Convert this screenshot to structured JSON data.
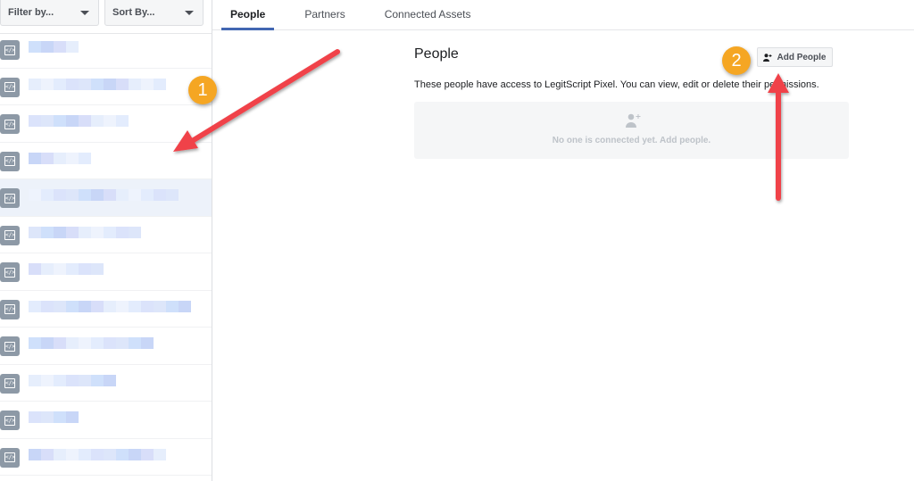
{
  "sidebar": {
    "filter_label": "Filter by...",
    "sort_label": "Sort By...",
    "item_count": 12,
    "selected_index": 4,
    "item_text_note": "pixelated/redacted"
  },
  "tabs": [
    {
      "label": "People",
      "active": true
    },
    {
      "label": "Partners",
      "active": false
    },
    {
      "label": "Connected Assets",
      "active": false
    }
  ],
  "panel": {
    "title": "People",
    "add_button_label": "Add People",
    "description": "These people have access to LegitScript Pixel. You can view, edit or delete their permissions.",
    "empty_message": "No one is connected yet. Add people."
  },
  "annotations": {
    "badge_1": "1",
    "badge_2": "2",
    "arrow_color": "#f0434a",
    "badge_color": "#f5a623"
  },
  "colors": {
    "accent": "#4267b2",
    "icon_gray": "#8d99a6"
  }
}
